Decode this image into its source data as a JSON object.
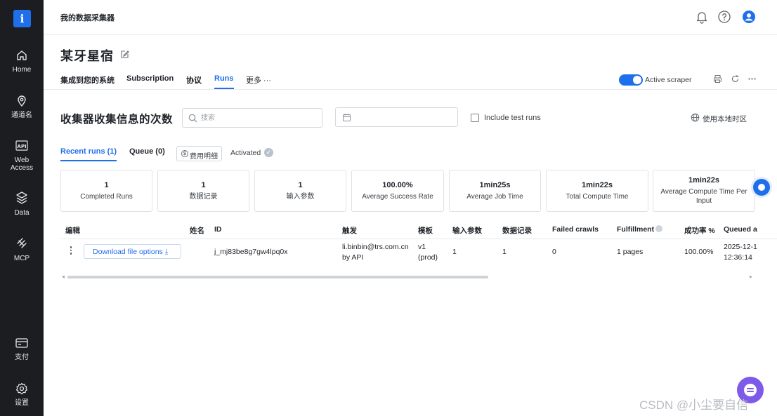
{
  "sidebar": {
    "logo": "i",
    "items": [
      {
        "label": "Home",
        "icon": "home-icon"
      },
      {
        "label": "通道名",
        "icon": "location-pin-icon"
      },
      {
        "label": "Web\nAccess",
        "icon": "api-icon"
      },
      {
        "label": "Data",
        "icon": "layers-icon"
      },
      {
        "label": "MCP",
        "icon": "mcp-icon"
      },
      {
        "label": "支付",
        "icon": "card-icon"
      },
      {
        "label": "设置",
        "icon": "gear-icon"
      }
    ]
  },
  "topbar": {
    "title": "我的数据采集器"
  },
  "header": {
    "page_title": "某牙星宿",
    "tabs": [
      {
        "label": "集成到您的系统"
      },
      {
        "label": "Subscription"
      },
      {
        "label": "协议"
      },
      {
        "label": "Runs"
      },
      {
        "label": "更多 ···"
      }
    ],
    "active_tab": "Runs",
    "toggle_label": "Active scraper",
    "toggle_on": true
  },
  "runs": {
    "section_title": "收集器收集信息的次数",
    "search_placeholder": "搜索",
    "include_test_runs": "Include test runs",
    "timezone": "使用本地时区",
    "subtabs": [
      {
        "label": "Recent runs (1)"
      },
      {
        "label": "Queue (0)"
      }
    ],
    "fee_button": "费用明细",
    "fee_icon": "$",
    "activated": "Activated",
    "activated_icon": "✓"
  },
  "stats": [
    {
      "value": "1",
      "label": "Completed Runs"
    },
    {
      "value": "1",
      "label": "数据记录"
    },
    {
      "value": "1",
      "label": "输入参数"
    },
    {
      "value": "100.00%",
      "label": "Average Success Rate"
    },
    {
      "value": "1min25s",
      "label": "Average Job Time"
    },
    {
      "value": "1min22s",
      "label": "Total Compute Time"
    },
    {
      "value": "1min22s",
      "label": "Average Compute Time Per Input"
    }
  ],
  "table": {
    "headers": [
      "编辑",
      "姓名",
      "ID",
      "触发",
      "模板",
      "输入参数",
      "数据记录",
      "Failed crawls",
      "Fulfillment",
      "成功率 %",
      "Queued a"
    ],
    "row": {
      "download_label": "Download file options ⤓",
      "name": "",
      "id": "j_mj83be8g7gw4lpq0x",
      "trigger_line1": "li.binbin@trs.com.cn",
      "trigger_line2": "by API",
      "template_line1": "v1",
      "template_line2": "(prod)",
      "input_params": "1",
      "records": "1",
      "failed": "0",
      "fulfillment": "1 pages",
      "success_rate": "100.00%",
      "queued_line1": "2025-12-1",
      "queued_line2": "12:36:14"
    }
  },
  "watermark": "CSDN @小尘要自信",
  "colors": {
    "accent": "#1f6feb",
    "sidebar_bg": "#1b1d21",
    "chat_button": "#7d5ae8"
  }
}
